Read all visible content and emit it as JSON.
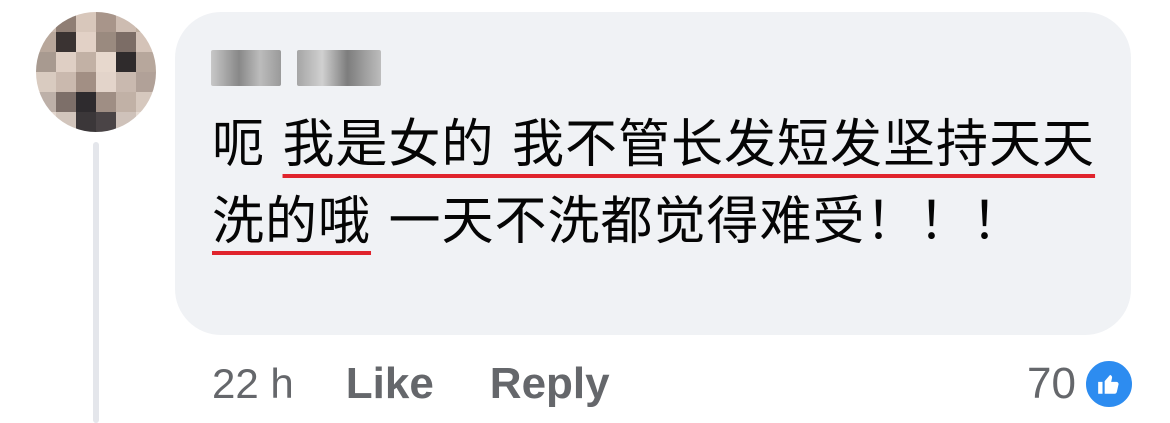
{
  "comment": {
    "author_name": "",
    "text_prefix": "呃 ",
    "text_underlined": "我是女的 我不管长发短发坚持天天洗的哦",
    "text_suffix": " 一天不洗都觉得难受！！！",
    "timestamp": "22 h",
    "like_label": "Like",
    "reply_label": "Reply",
    "reaction_count": "70"
  },
  "icons": {
    "avatar": "avatar-blurred",
    "reaction": "thumbs-up-icon"
  },
  "colors": {
    "bubble": "#f0f2f5",
    "underline": "#e0242d",
    "muted": "#65676b",
    "like_blue": "#2d8cf0"
  }
}
